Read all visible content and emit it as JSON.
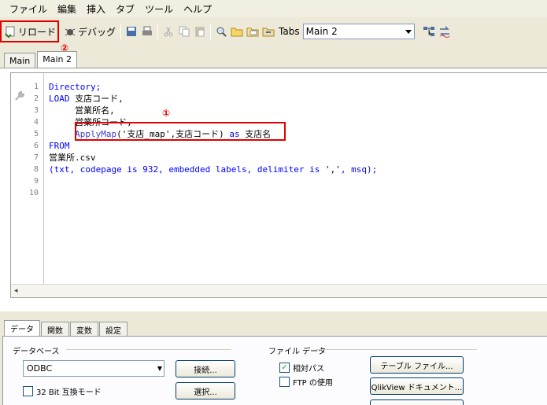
{
  "menu": [
    "ファイル",
    "編集",
    "挿入",
    "タブ",
    "ツール",
    "ヘルプ"
  ],
  "toolbar": {
    "reload_label": "リロード",
    "debug_label": "デバッグ",
    "tabs_label": "Tabs",
    "tab_select_value": "Main 2"
  },
  "script_tabs": [
    {
      "label": "Main"
    },
    {
      "label": "Main 2"
    }
  ],
  "annotations": {
    "circle1": "①",
    "circle2": "②"
  },
  "editor": {
    "line_numbers": [
      "1",
      "2",
      "3",
      "4",
      "5",
      "6",
      "7",
      "8",
      "9",
      "10"
    ],
    "lines": [
      "Directory;",
      "LOAD 支店コード,",
      "     営業所名,",
      "     営業所コード,",
      "     ApplyMap('支店_map',支店コード) as 支店名",
      "FROM",
      "営業所.csv",
      "(txt, codepage is 932, embedded labels, delimiter is ',', msq);"
    ]
  },
  "bottom_tabs": [
    "データ",
    "関数",
    "変数",
    "設定"
  ],
  "data_panel": {
    "database_group": "データベース",
    "database_select": "ODBC",
    "connect_button": "接続...",
    "select_button": "選択...",
    "compat_checkbox": "32 Bit 互換モード",
    "compat_checked": false,
    "file_data_group": "ファイル データ",
    "relative_path_checkbox": "相対パス",
    "relative_path_checked": true,
    "ftp_checkbox": "FTP の使用",
    "ftp_checked": false,
    "table_file_button": "テーブル ファイル...",
    "qlikview_doc_button": "QlikView ドキュメント...",
    "checkmark": "✓"
  },
  "colors": {
    "highlight_red": "#e00000",
    "keyword_blue": "#0000ff"
  }
}
